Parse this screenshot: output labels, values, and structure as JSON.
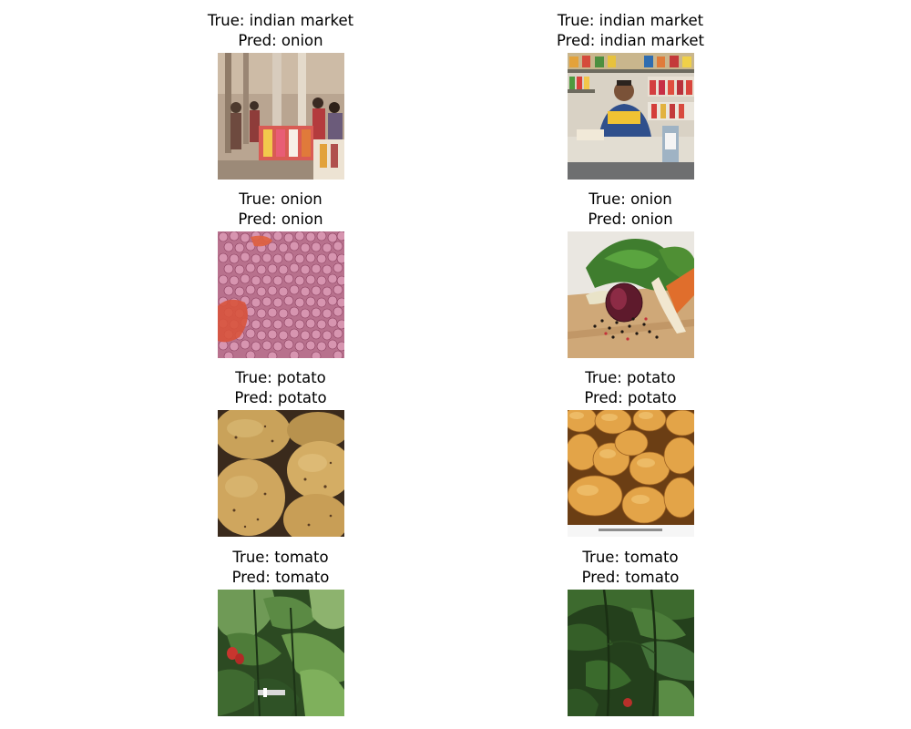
{
  "predictions": [
    {
      "true_text": "True: indian market",
      "pred_text": "Pred: onion",
      "image": "indian-market-stall-photo"
    },
    {
      "true_text": "True: indian market",
      "pred_text": "Pred: indian market",
      "image": "shopkeeper-at-counter-photo"
    },
    {
      "true_text": "True: onion",
      "pred_text": "Pred: onion",
      "image": "pile-of-red-onions-photo"
    },
    {
      "true_text": "True: onion",
      "pred_text": "Pred: onion",
      "image": "onion-on-cutting-board-photo"
    },
    {
      "true_text": "True: potato",
      "pred_text": "Pred: potato",
      "image": "potatoes-closeup-photo"
    },
    {
      "true_text": "True: potato",
      "pred_text": "Pred: potato",
      "image": "potatoes-stockphoto-photo"
    },
    {
      "true_text": "True: tomato",
      "pred_text": "Pred: tomato",
      "image": "tomato-plant-leaves-photo"
    },
    {
      "true_text": "True: tomato",
      "pred_text": "Pred: tomato",
      "image": "tomato-plant-stems-photo"
    }
  ]
}
